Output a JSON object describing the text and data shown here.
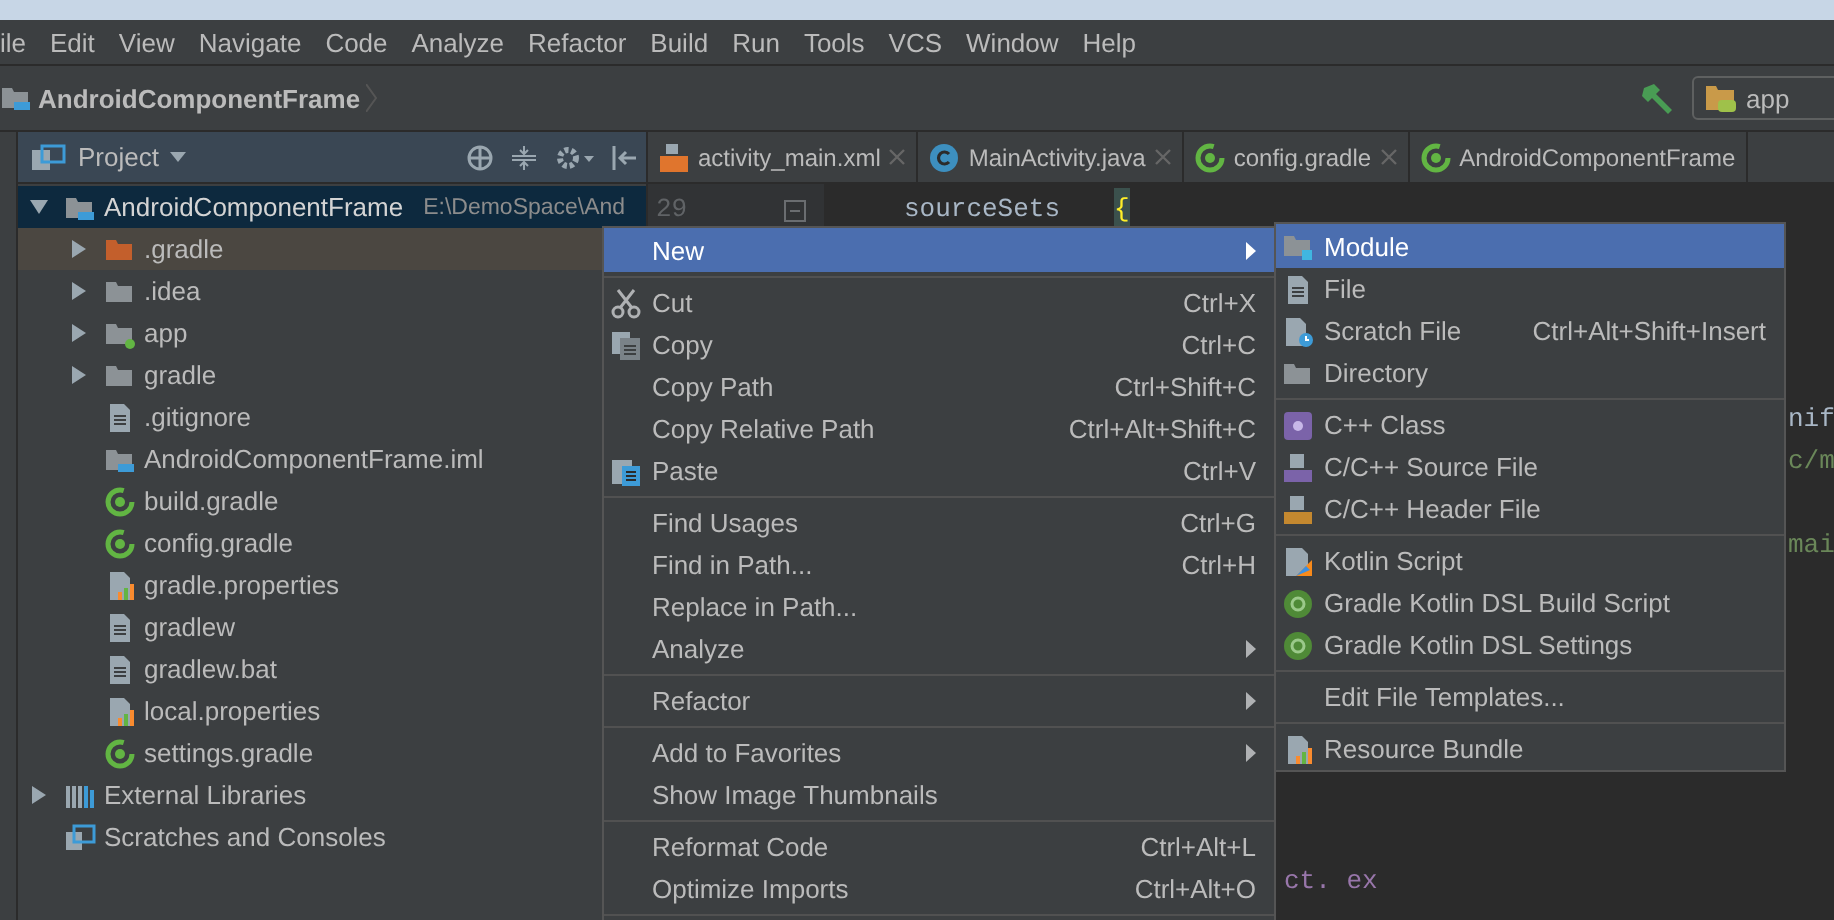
{
  "menu_bar": [
    "ile",
    "Edit",
    "View",
    "Navigate",
    "Code",
    "Analyze",
    "Refactor",
    "Build",
    "Run",
    "Tools",
    "VCS",
    "Window",
    "Help"
  ],
  "nav_bar": {
    "breadcrumb": "AndroidComponentFrame",
    "run_config": "app"
  },
  "project_panel": {
    "title": "Project",
    "tree": [
      {
        "label": "AndroidComponentFrame",
        "path": "E:\\DemoSpace\\And",
        "kind": "module-folder",
        "expanded": true,
        "selected": true,
        "hovered": false,
        "children": [
          {
            "label": ".gradle",
            "kind": "excluded-folder",
            "expanded": false,
            "selected": false,
            "hovered": true
          },
          {
            "label": ".idea",
            "kind": "folder",
            "expanded": false,
            "selected": false,
            "hovered": false
          },
          {
            "label": "app",
            "kind": "android-folder",
            "expanded": false,
            "selected": false,
            "hovered": false
          },
          {
            "label": "gradle",
            "kind": "folder",
            "expanded": false,
            "selected": false,
            "hovered": false
          },
          {
            "label": ".gitignore",
            "kind": "text-file",
            "selected": false,
            "hovered": false
          },
          {
            "label": "AndroidComponentFrame.iml",
            "kind": "module-folder",
            "selected": false,
            "hovered": false
          },
          {
            "label": "build.gradle",
            "kind": "gradle",
            "selected": false,
            "hovered": false
          },
          {
            "label": "config.gradle",
            "kind": "gradle",
            "selected": false,
            "hovered": false
          },
          {
            "label": "gradle.properties",
            "kind": "properties",
            "selected": false,
            "hovered": false
          },
          {
            "label": "gradlew",
            "kind": "text-file",
            "selected": false,
            "hovered": false
          },
          {
            "label": "gradlew.bat",
            "kind": "text-file",
            "selected": false,
            "hovered": false
          },
          {
            "label": "local.properties",
            "kind": "properties",
            "selected": false,
            "hovered": false
          },
          {
            "label": "settings.gradle",
            "kind": "gradle",
            "selected": false,
            "hovered": false
          }
        ]
      },
      {
        "label": "External Libraries",
        "kind": "libraries",
        "expanded": false,
        "selected": false,
        "hovered": false
      },
      {
        "label": "Scratches and Consoles",
        "kind": "scratches",
        "selected": false,
        "hovered": false
      }
    ]
  },
  "tabs": [
    {
      "label": "activity_main.xml",
      "kind": "xml",
      "closable": true
    },
    {
      "label": "MainActivity.java",
      "kind": "class",
      "closable": true
    },
    {
      "label": "config.gradle",
      "kind": "gradle",
      "closable": true
    },
    {
      "label": "AndroidComponentFrame",
      "kind": "gradle",
      "closable": false
    }
  ],
  "editor": {
    "line_number": "29",
    "fragments": [
      {
        "text": "sourceSets",
        "kind": "plain"
      },
      {
        "text": "{",
        "kind": "brace"
      },
      {
        "text": "nif",
        "kind": "plain"
      },
      {
        "text": "c/m",
        "kind": "string"
      },
      {
        "text": "mai",
        "kind": "string"
      },
      {
        "text": "ct. ex",
        "kind": "field"
      }
    ]
  },
  "context_menu": [
    [
      {
        "label": "New",
        "submenu": true,
        "selected": true,
        "kind": "plain"
      }
    ],
    [
      {
        "label": "Cut",
        "shortcut": "Ctrl+X",
        "kind": "scissors",
        "selected": false
      },
      {
        "label": "Copy",
        "shortcut": "Ctrl+C",
        "kind": "copy",
        "selected": false
      },
      {
        "label": "Copy Path",
        "shortcut": "Ctrl+Shift+C",
        "kind": "plain",
        "selected": false
      },
      {
        "label": "Copy Relative Path",
        "shortcut": "Ctrl+Alt+Shift+C",
        "kind": "plain",
        "selected": false
      },
      {
        "label": "Paste",
        "shortcut": "Ctrl+V",
        "kind": "paste",
        "selected": false
      }
    ],
    [
      {
        "label": "Find Usages",
        "shortcut": "Ctrl+G",
        "kind": "plain",
        "selected": false
      },
      {
        "label": "Find in Path...",
        "shortcut": "Ctrl+H",
        "kind": "plain",
        "selected": false
      },
      {
        "label": "Replace in Path...",
        "kind": "plain",
        "selected": false
      },
      {
        "label": "Analyze",
        "submenu": true,
        "kind": "plain",
        "selected": false
      }
    ],
    [
      {
        "label": "Refactor",
        "submenu": true,
        "kind": "plain",
        "selected": false
      }
    ],
    [
      {
        "label": "Add to Favorites",
        "submenu": true,
        "kind": "plain",
        "selected": false
      },
      {
        "label": "Show Image Thumbnails",
        "kind": "plain",
        "selected": false
      }
    ],
    [
      {
        "label": "Reformat Code",
        "shortcut": "Ctrl+Alt+L",
        "kind": "plain",
        "selected": false
      },
      {
        "label": "Optimize Imports",
        "shortcut": "Ctrl+Alt+O",
        "kind": "plain",
        "selected": false
      }
    ]
  ],
  "new_submenu": [
    [
      {
        "label": "Module",
        "kind": "module",
        "selected": true
      },
      {
        "label": "File",
        "kind": "text-file",
        "selected": false
      },
      {
        "label": "Scratch File",
        "shortcut": "Ctrl+Alt+Shift+Insert",
        "kind": "scratch",
        "selected": false
      },
      {
        "label": "Directory",
        "kind": "folder",
        "selected": false
      }
    ],
    [
      {
        "label": "C++ Class",
        "kind": "cpp-class",
        "selected": false
      },
      {
        "label": "C/C++ Source File",
        "kind": "cpp-source",
        "selected": false
      },
      {
        "label": "C/C++ Header File",
        "kind": "cpp-header",
        "selected": false
      }
    ],
    [
      {
        "label": "Kotlin Script",
        "kind": "kotlin",
        "selected": false
      },
      {
        "label": "Gradle Kotlin DSL Build Script",
        "kind": "gradle-g",
        "selected": false
      },
      {
        "label": "Gradle Kotlin DSL Settings",
        "kind": "gradle-g",
        "selected": false
      }
    ],
    [
      {
        "label": "Edit File Templates...",
        "kind": "plain",
        "selected": false
      }
    ],
    [
      {
        "label": "Resource Bundle",
        "kind": "properties",
        "selected": false
      }
    ]
  ]
}
